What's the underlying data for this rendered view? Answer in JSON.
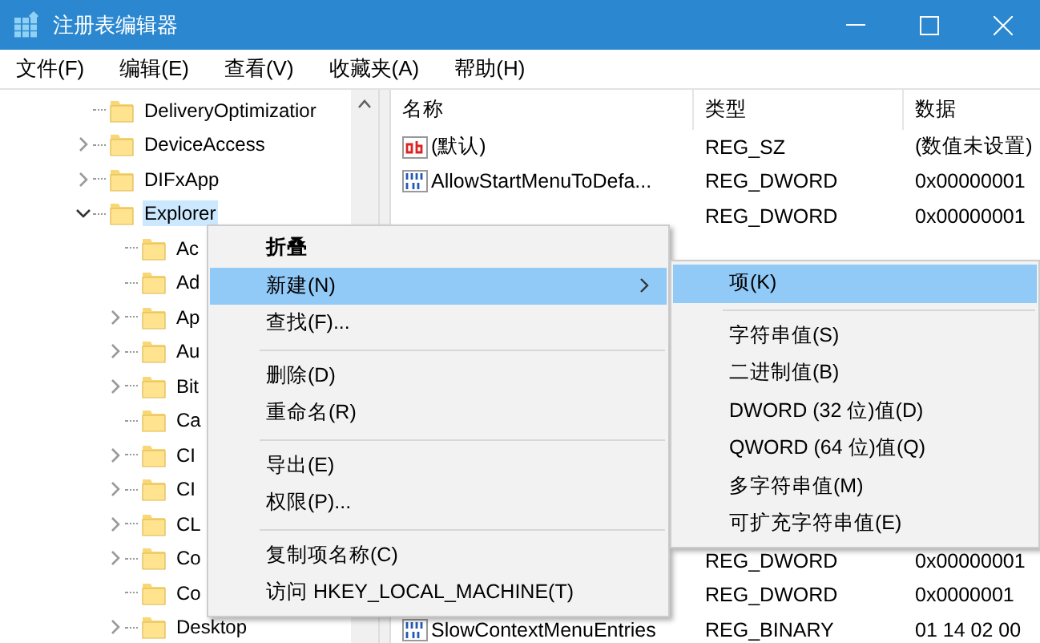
{
  "window": {
    "title": "注册表编辑器"
  },
  "menu_bar": [
    "文件(F)",
    "编辑(E)",
    "查看(V)",
    "收藏夹(A)",
    "帮助(H)"
  ],
  "tree": {
    "items": [
      {
        "label": "DeliveryOptimizatior",
        "expandable": false,
        "selected": false
      },
      {
        "label": "DeviceAccess",
        "expandable": true,
        "expanded": false,
        "selected": false
      },
      {
        "label": "DIFxApp",
        "expandable": true,
        "expanded": false,
        "selected": false
      },
      {
        "label": "Explorer",
        "expandable": true,
        "expanded": true,
        "selected": true,
        "children": [
          {
            "label": "Ac",
            "expandable": false,
            "selected": false
          },
          {
            "label": "Ad",
            "expandable": false,
            "selected": false
          },
          {
            "label": "Ap",
            "expandable": true,
            "expanded": false,
            "selected": false
          },
          {
            "label": "Au",
            "expandable": true,
            "expanded": false,
            "selected": false
          },
          {
            "label": "Bit",
            "expandable": true,
            "expanded": false,
            "selected": false
          },
          {
            "label": "Ca",
            "expandable": false,
            "selected": false
          },
          {
            "label": "CI",
            "expandable": true,
            "expanded": false,
            "selected": false
          },
          {
            "label": "CI",
            "expandable": true,
            "expanded": false,
            "selected": false
          },
          {
            "label": "CL",
            "expandable": true,
            "expanded": false,
            "selected": false
          },
          {
            "label": "Co",
            "expandable": true,
            "expanded": false,
            "selected": false
          },
          {
            "label": "Co",
            "expandable": false,
            "selected": false
          },
          {
            "label": "Desktop",
            "expandable": true,
            "expanded": false,
            "selected": false
          }
        ]
      }
    ]
  },
  "values": {
    "columns": [
      "名称",
      "类型",
      "数据"
    ],
    "rows_top": [
      {
        "kind": "string",
        "name": "(默认)",
        "type": "REG_SZ",
        "data": "(数值未设置)"
      },
      {
        "kind": "binary",
        "name": "AllowStartMenuToDefa...",
        "type": "REG_DWORD",
        "data": "0x00000001"
      },
      {
        "type": "REG_DWORD",
        "data": "0x00000001"
      }
    ],
    "rows_bottom": [
      {
        "type": "REG_DWORD",
        "data": "0x00000001"
      },
      {
        "type": "REG_DWORD",
        "data": "0x0000001"
      },
      {
        "kind": "binary",
        "name": "SlowContextMenuEntries",
        "type": "REG_BINARY",
        "data": "01 14 02 00"
      }
    ]
  },
  "context_menu": [
    {
      "kind": "item",
      "label": "折叠",
      "default": true,
      "selected": false,
      "submenu": false
    },
    {
      "kind": "item",
      "label": "新建(N)",
      "default": false,
      "selected": true,
      "submenu": true
    },
    {
      "kind": "item",
      "label": "查找(F)...",
      "default": false,
      "selected": false,
      "submenu": false
    },
    {
      "kind": "separator"
    },
    {
      "kind": "item",
      "label": "删除(D)",
      "default": false,
      "selected": false,
      "submenu": false
    },
    {
      "kind": "item",
      "label": "重命名(R)",
      "default": false,
      "selected": false,
      "submenu": false
    },
    {
      "kind": "separator"
    },
    {
      "kind": "item",
      "label": "导出(E)",
      "default": false,
      "selected": false,
      "submenu": false
    },
    {
      "kind": "item",
      "label": "权限(P)...",
      "default": false,
      "selected": false,
      "submenu": false
    },
    {
      "kind": "separator"
    },
    {
      "kind": "item",
      "label": "复制项名称(C)",
      "default": false,
      "selected": false,
      "submenu": false
    },
    {
      "kind": "item",
      "label": "访问 HKEY_LOCAL_MACHINE(T)",
      "default": false,
      "selected": false,
      "submenu": false
    }
  ],
  "submenu": [
    {
      "kind": "item",
      "label": "项(K)",
      "selected": true
    },
    {
      "kind": "separator"
    },
    {
      "kind": "item",
      "label": "字符串值(S)",
      "selected": false
    },
    {
      "kind": "item",
      "label": "二进制值(B)",
      "selected": false
    },
    {
      "kind": "item",
      "label": "DWORD (32 位)值(D)",
      "selected": false
    },
    {
      "kind": "item",
      "label": "QWORD (64 位)值(Q)",
      "selected": false
    },
    {
      "kind": "item",
      "label": "多字符串值(M)",
      "selected": false
    },
    {
      "kind": "item",
      "label": "可扩充字符串值(E)",
      "selected": false
    }
  ]
}
